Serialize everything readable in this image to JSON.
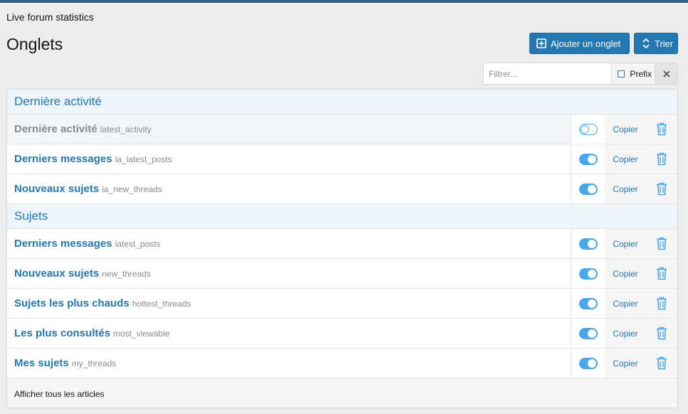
{
  "header": {
    "breadcrumb": "Live forum statistics",
    "title": "Onglets",
    "add_button": "Ajouter un onglet",
    "sort_button": "Trier"
  },
  "filter": {
    "placeholder": "Filtrer...",
    "prefix_label": "Prefix"
  },
  "sections": [
    {
      "title": "Dernière activité",
      "rows": [
        {
          "title": "Dernière activité",
          "key": "latest_activity",
          "enabled": false
        },
        {
          "title": "Derniers messages",
          "key": "la_latest_posts",
          "enabled": true
        },
        {
          "title": "Nouveaux sujets",
          "key": "la_new_threads",
          "enabled": true
        }
      ]
    },
    {
      "title": "Sujets",
      "rows": [
        {
          "title": "Derniers messages",
          "key": "latest_posts",
          "enabled": true
        },
        {
          "title": "Nouveaux sujets",
          "key": "new_threads",
          "enabled": true
        },
        {
          "title": "Sujets les plus chauds",
          "key": "hottest_threads",
          "enabled": true
        },
        {
          "title": "Les plus consultés",
          "key": "most_viewable",
          "enabled": true
        },
        {
          "title": "Mes sujets",
          "key": "my_threads",
          "enabled": true
        }
      ]
    }
  ],
  "row_actions": {
    "copy_label": "Copier",
    "delete_icon": "trash-icon"
  },
  "footer": {
    "text": "Afficher tous les articles"
  },
  "colors": {
    "accent": "#2577b1",
    "toggle_on": "#47a7eb",
    "section_bg": "#edf4fa"
  }
}
